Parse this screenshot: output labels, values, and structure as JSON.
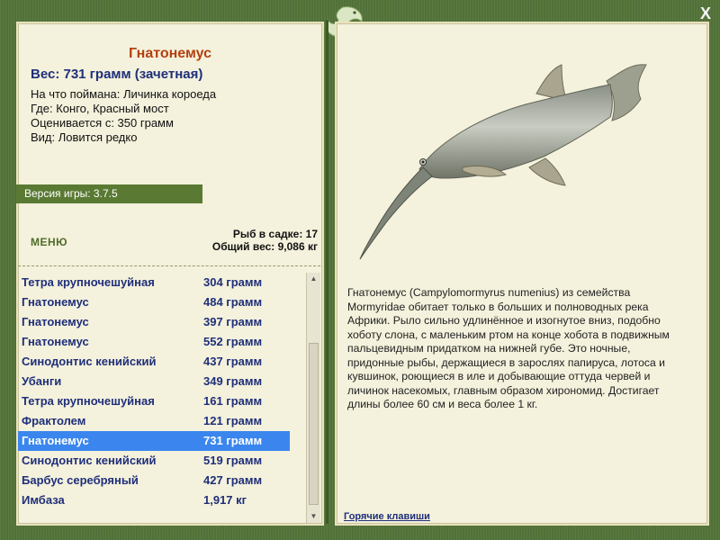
{
  "window": {
    "close_label": "X"
  },
  "fish": {
    "name": "Гнатонемус",
    "weight_line": "Вес: 731 грамм (зачетная)",
    "caught_on": "На что поймана: Личинка короеда",
    "where": "Где: Конго, Красный мост",
    "rated_from": "Оценивается с: 350 грамм",
    "kind": "Вид: Ловится редко"
  },
  "version": "Версия игры: 3.7.5",
  "menu_label": "МЕНЮ",
  "stats": {
    "fish_count": "Рыб в садке: 17",
    "total_weight": "Общий вес: 9,086 кг"
  },
  "catch_list": [
    {
      "name": "Тетра крупночешуйная",
      "weight": "304 грамм"
    },
    {
      "name": "Гнатонемус",
      "weight": "484 грамм"
    },
    {
      "name": "Гнатонемус",
      "weight": "397 грамм"
    },
    {
      "name": "Гнатонемус",
      "weight": "552 грамм"
    },
    {
      "name": "Синодонтис кенийский",
      "weight": "437 грамм"
    },
    {
      "name": "Убанги",
      "weight": "349 грамм"
    },
    {
      "name": "Тетра крупночешуйная",
      "weight": "161 грамм"
    },
    {
      "name": "Фрактолем",
      "weight": "121 грамм"
    },
    {
      "name": "Гнатонемус",
      "weight": "731 грамм"
    },
    {
      "name": "Синодонтис кенийский",
      "weight": "519 грамм"
    },
    {
      "name": "Барбус серебряный",
      "weight": "427 грамм"
    },
    {
      "name": "Имбаза",
      "weight": "1,917 кг"
    }
  ],
  "selected_index": 8,
  "description": "Гнатонемус (Campylomormyrus numenius) из семейства Mormyridae обитает только в больших и полноводных река Африки. Рыло сильно удлинённое и изогнутое вниз, подобно хоботу слона, с маленьким ртом на конце хобота в подвижным пальцевидным придатком на нижней губе. Это ночные, придонные рыбы, держащиеся в зарослях папируса, лотоса и кувшинок, роющиеся в иле и добывающие оттуда червей и личинок насекомых, главным образом хирономид. Достигает длины более 60 см и веса более 1 кг.",
  "hotkeys_label": "Горячие клавиши",
  "icons": {
    "close": "close-icon",
    "logo": "leaping-fish-logo-icon",
    "fish_image": "gnathonemus-fish-image"
  }
}
